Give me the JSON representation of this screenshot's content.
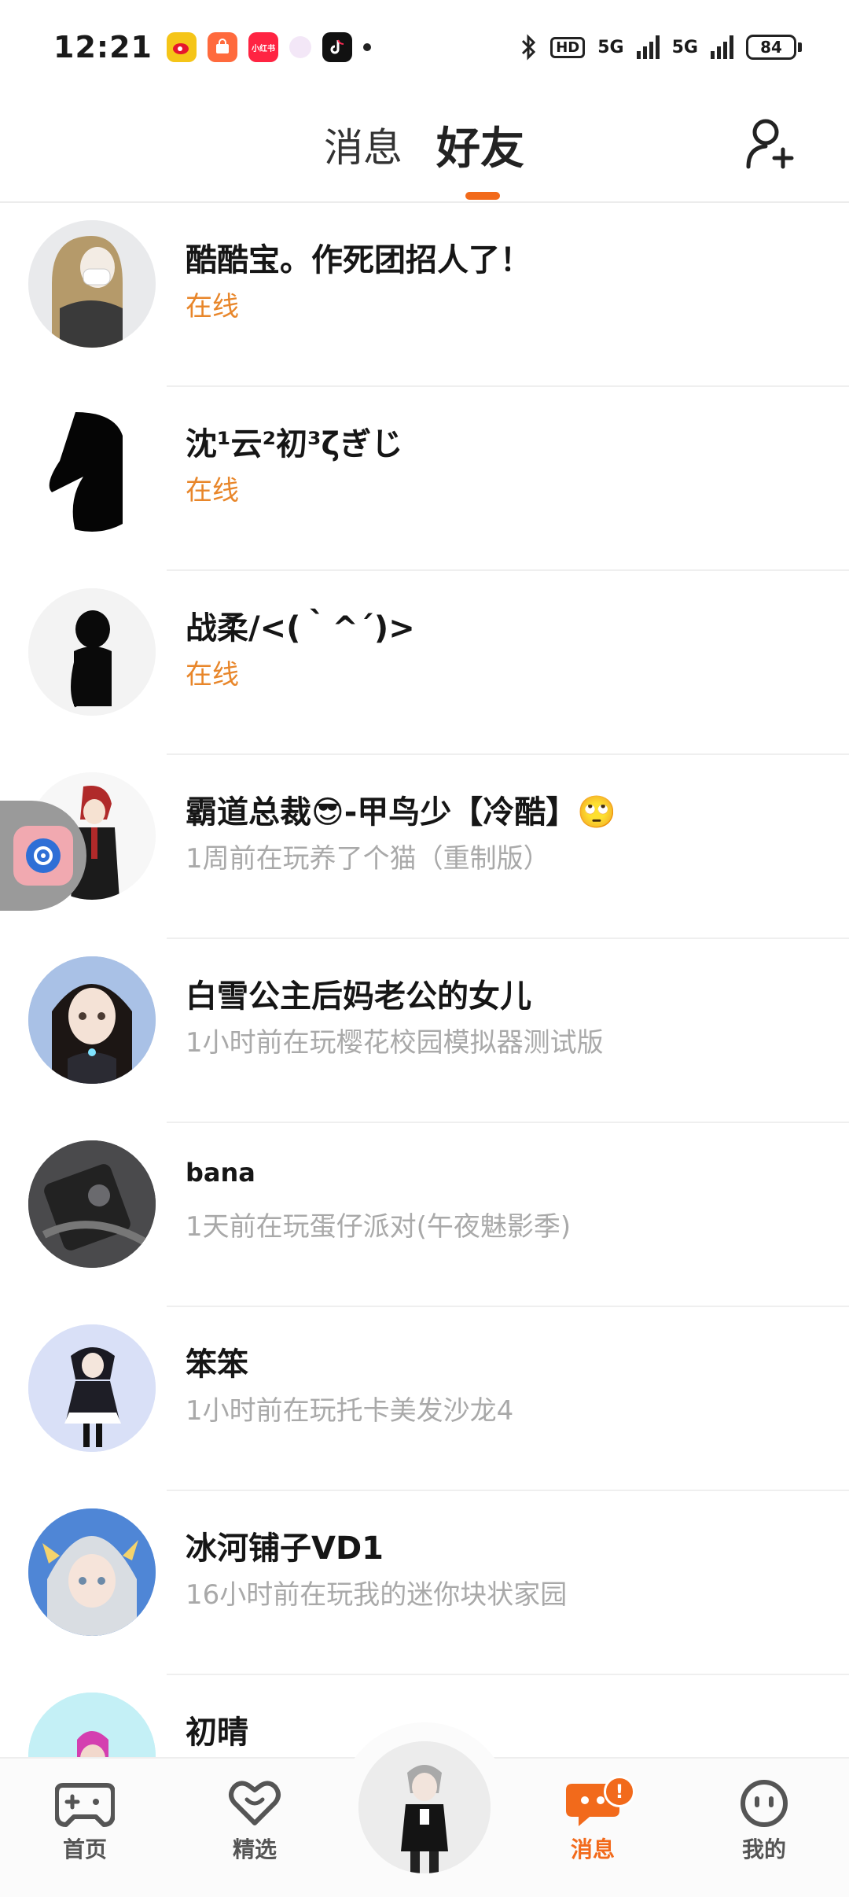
{
  "status_bar": {
    "time": "12:21",
    "notification_icons": [
      "weibo-icon",
      "taobao-icon",
      "xiaohongshu-icon",
      "bubble-icon",
      "tiktok-icon"
    ],
    "xhs_label": "小红书",
    "network_1": "5G",
    "network_2": "5G",
    "hd_label": "HD",
    "battery": "84"
  },
  "top_nav": {
    "tabs": [
      {
        "label": "消息",
        "active": false
      },
      {
        "label": "好友",
        "active": true
      }
    ],
    "accent_color": "#f26a1b"
  },
  "friends": [
    {
      "name": "酷酷宝。作死团招人了！",
      "status": "在线",
      "online": true
    },
    {
      "name": "沈¹云²初³ζぎじ",
      "status": "在线",
      "online": true
    },
    {
      "name": "战柔/<(｀^´)>",
      "status": "在线",
      "online": true
    },
    {
      "name": "霸道总裁😎-甲鸟少【冷酷】🙄",
      "status": "1周前在玩养了个猫（重制版）",
      "online": false
    },
    {
      "name": "白雪公主后妈老公的女儿",
      "status": "1小时前在玩樱花校园模拟器测试版",
      "online": false
    },
    {
      "name": "bana",
      "status": "1天前在玩蛋仔派对(午夜魅影季)",
      "online": false
    },
    {
      "name": "笨笨",
      "status": "1小时前在玩托卡美发沙龙4",
      "online": false
    },
    {
      "name": "冰河铺子VD1",
      "status": "16小时前在玩我的迷你块状家园",
      "online": false
    },
    {
      "name": "初晴",
      "status": "",
      "online": false
    }
  ],
  "bottom_nav": {
    "items": [
      {
        "label": "首页",
        "icon": "gamepad-icon",
        "active": false
      },
      {
        "label": "精选",
        "icon": "heart-icon",
        "active": false
      },
      {
        "label": "消息",
        "icon": "chat-icon",
        "active": true,
        "badge": "!"
      },
      {
        "label": "我的",
        "icon": "face-icon",
        "active": false
      }
    ]
  }
}
